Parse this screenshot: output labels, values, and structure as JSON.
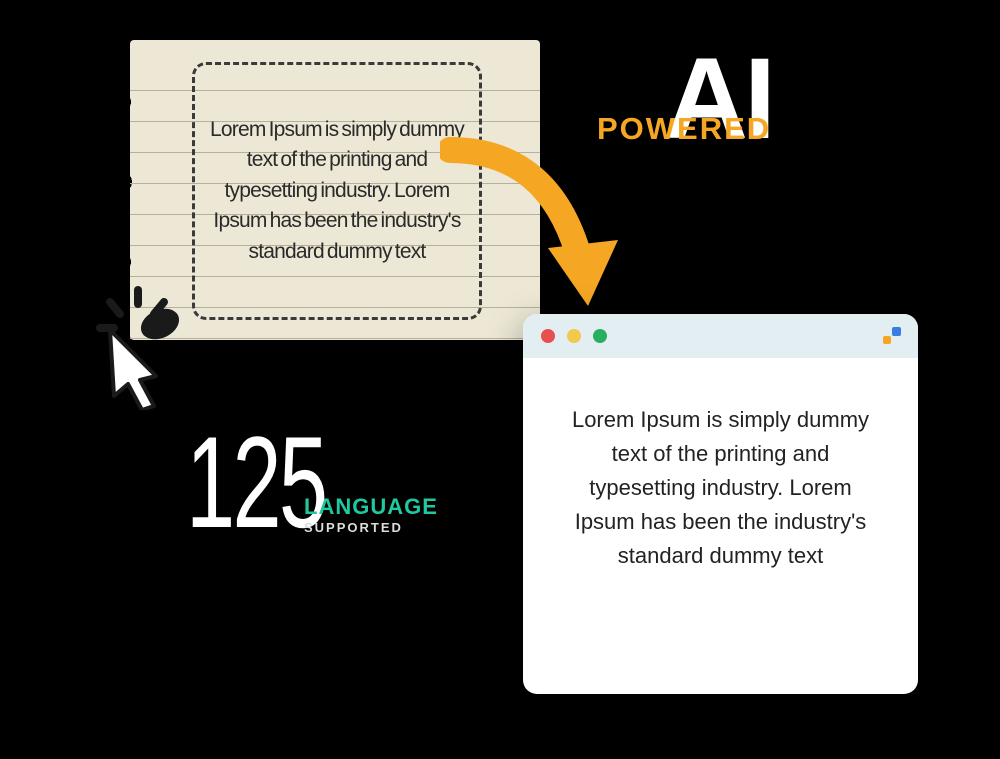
{
  "notepad": {
    "text": "Lorem Ipsum is simply dummy text of the printing and typesetting industry. Lorem Ipsum has been the industry's standard dummy text"
  },
  "headline": {
    "ai": "AI",
    "powered": "POWERED"
  },
  "stats": {
    "number": "125",
    "label": "LANGUAGE",
    "sublabel": "SUPPORTED"
  },
  "browser": {
    "text": "Lorem Ipsum is simply dummy text of the printing and typesetting industry. Lorem Ipsum has been the industry's standard dummy text"
  },
  "colors": {
    "accent_orange": "#f5a623",
    "accent_teal": "#1fc9a0"
  }
}
